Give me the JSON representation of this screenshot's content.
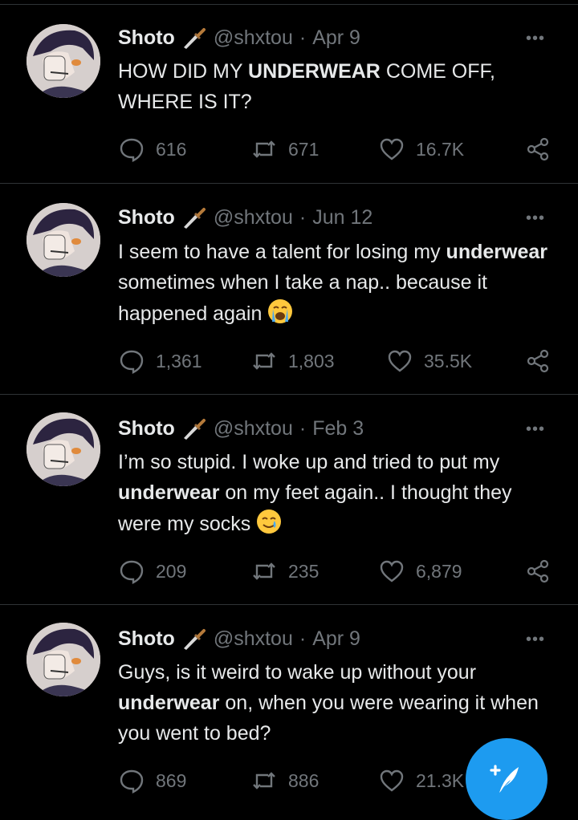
{
  "tweets": [
    {
      "name": "Shoto",
      "handle": "@shxtou",
      "sep": "·",
      "date": "Apr 9",
      "text_parts": [
        "HOW DID MY ",
        "UNDERWEAR",
        " COME OFF, WHERE IS IT?"
      ],
      "emoji": "",
      "replies": "616",
      "retweets": "671",
      "likes": "16.7K"
    },
    {
      "name": "Shoto",
      "handle": "@shxtou",
      "sep": "·",
      "date": "Jun 12",
      "text_parts": [
        "I seem to have a talent for losing my ",
        "underwear",
        " sometimes when I take a nap.. because it happened again"
      ],
      "emoji": "crying-face-emoji",
      "replies": "1,361",
      "retweets": "1,803",
      "likes": "35.5K"
    },
    {
      "name": "Shoto",
      "handle": "@shxtou",
      "sep": "·",
      "date": "Feb 3",
      "text_parts": [
        "I’m so stupid. I woke up and tried to put my ",
        "underwear",
        " on my feet again.. I thought they were my socks"
      ],
      "emoji": "smiling-tear-emoji",
      "replies": "209",
      "retweets": "235",
      "likes": "6,879"
    },
    {
      "name": "Shoto",
      "handle": "@shxtou",
      "sep": "·",
      "date": "Apr 9",
      "text_parts": [
        "Guys, is it weird to wake up without your ",
        "underwear",
        " on, when you were wearing it when you went to bed?"
      ],
      "emoji": "",
      "replies": "869",
      "retweets": "886",
      "likes": "21.3K"
    }
  ],
  "more_label": "•••",
  "compose_icon": "compose-feather-icon",
  "badge_icon": "dagger-icon",
  "colors": {
    "accent": "#1d9bf0",
    "muted": "#71767b",
    "text": "#e7e9ea",
    "border": "#2f3336"
  }
}
